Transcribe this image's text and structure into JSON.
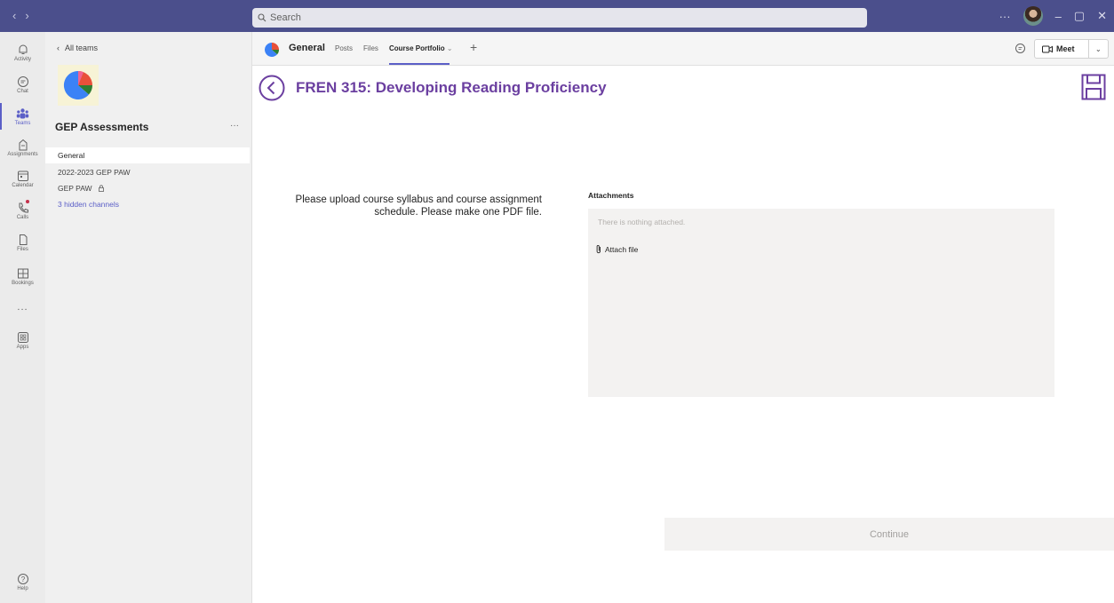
{
  "titlebar": {
    "search_placeholder": "Search",
    "more": "···",
    "minimize": "–",
    "maximize": "▢",
    "close": "✕"
  },
  "rail": {
    "items": [
      {
        "label": "Activity",
        "icon": "bell-icon"
      },
      {
        "label": "Chat",
        "icon": "chat-icon"
      },
      {
        "label": "Teams",
        "icon": "teams-icon"
      },
      {
        "label": "Assignments",
        "icon": "assignments-icon"
      },
      {
        "label": "Calendar",
        "icon": "calendar-icon"
      },
      {
        "label": "Calls",
        "icon": "phone-icon"
      },
      {
        "label": "Files",
        "icon": "file-icon"
      },
      {
        "label": "Bookings",
        "icon": "bookings-icon"
      },
      {
        "label": "...",
        "icon": "more-icon"
      },
      {
        "label": "Apps",
        "icon": "apps-icon"
      },
      {
        "label": "Help",
        "icon": "help-icon"
      }
    ]
  },
  "panel": {
    "back_label": "All teams",
    "team_name": "GEP Assessments",
    "more": "···",
    "channels": [
      {
        "label": "General"
      },
      {
        "label": "2022-2023 GEP PAW"
      },
      {
        "label": "GEP PAW"
      },
      {
        "label": "3 hidden channels"
      }
    ]
  },
  "channel_bar": {
    "title": "General",
    "tabs": [
      "Posts",
      "Files",
      "Course Portfolio"
    ],
    "add": "+",
    "meet_label": "Meet"
  },
  "main": {
    "title": "FREN 315: Developing Reading Proficiency",
    "instructions": "Please upload course syllabus and course assignment schedule. Please make one PDF file.",
    "attachments_label": "Attachments",
    "attachments_empty": "There is nothing attached.",
    "attach_file_label": "Attach file",
    "continue_label": "Continue"
  },
  "colors": {
    "titlebar": "#4b4f8c",
    "accent": "#5b5fc7",
    "title_purple": "#6b3fa0"
  }
}
